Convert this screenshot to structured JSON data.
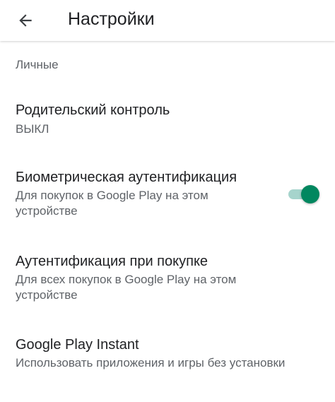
{
  "appbar": {
    "title": "Настройки",
    "back_icon": "arrow-left-icon"
  },
  "section": {
    "header": "Личные"
  },
  "items": [
    {
      "title": "Родительский контроль",
      "subtitle": "ВЫКЛ"
    },
    {
      "title": "Биометрическая аутентификация",
      "subtitle": "Для покупок в Google Play на этом устройстве",
      "toggle_on": true
    },
    {
      "title": "Аутентификация при покупке",
      "subtitle": "Для всех покупок в Google Play на этом устройстве"
    },
    {
      "title": "Google Play Instant",
      "subtitle": "Использовать приложения и игры без установки"
    }
  ],
  "colors": {
    "accent": "#01875f",
    "accent_track": "#a6d4cc",
    "text_primary": "#202124",
    "text_secondary": "#5f6368"
  }
}
